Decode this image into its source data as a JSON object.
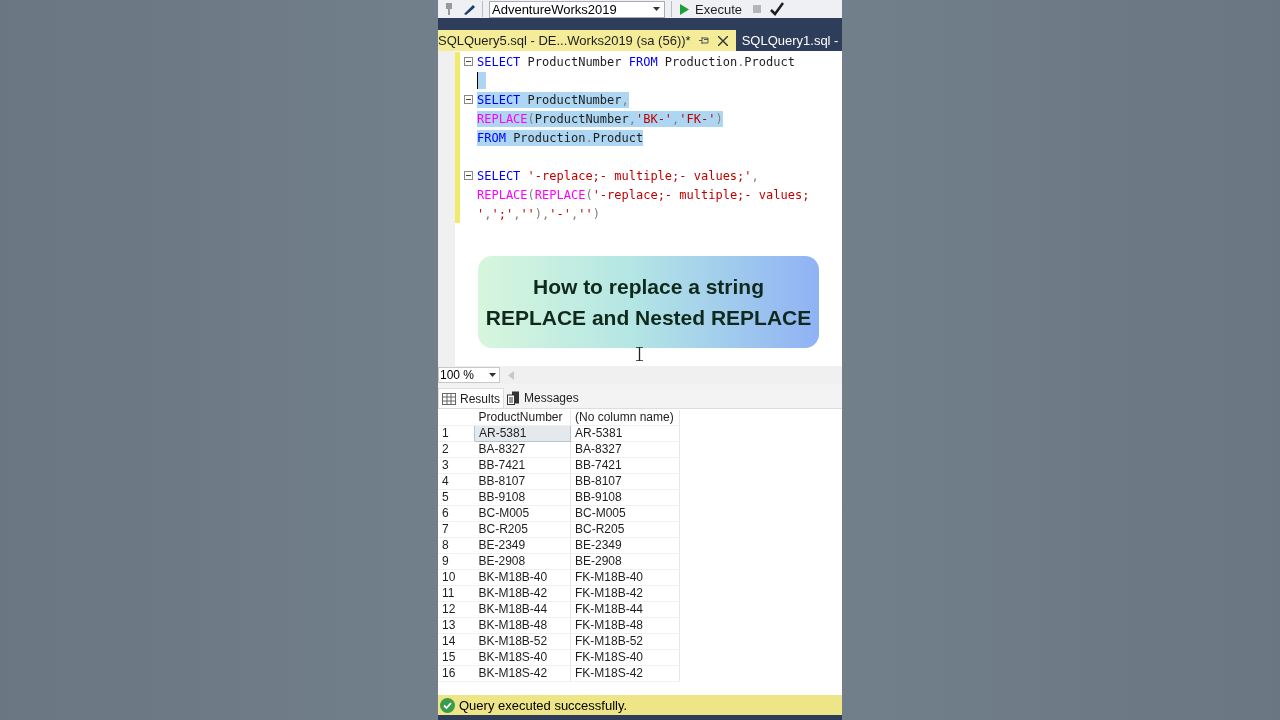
{
  "toolbar": {
    "database": "AdventureWorks2019",
    "execute": "Execute"
  },
  "tabs": [
    {
      "label": "SQLQuery5.sql - DE...Works2019 (sa (56))*",
      "selected": true
    },
    {
      "label": "SQLQuery1.sql -",
      "selected": false
    }
  ],
  "editor": {
    "lines": [
      {
        "fold": true,
        "selected": false,
        "tokens": [
          {
            "kind": "kw",
            "text": "SELECT"
          },
          {
            "kind": "id",
            "text": " ProductNumber "
          },
          {
            "kind": "kw",
            "text": "FROM"
          },
          {
            "kind": "id",
            "text": " Production"
          },
          {
            "kind": "punct",
            "text": "."
          },
          {
            "kind": "id",
            "text": "Product"
          }
        ]
      },
      {
        "fold": false,
        "selected": true
      },
      {
        "fold": true,
        "selected": true,
        "tokens": [
          {
            "kind": "kw",
            "text": "SELECT"
          },
          {
            "kind": "id",
            "text": " ProductNumber"
          },
          {
            "kind": "punct",
            "text": ","
          }
        ]
      },
      {
        "fold": false,
        "selected": true,
        "tokens": [
          {
            "kind": "fn",
            "text": "REPLACE"
          },
          {
            "kind": "punct",
            "text": "("
          },
          {
            "kind": "id",
            "text": "ProductNumber"
          },
          {
            "kind": "punct",
            "text": ","
          },
          {
            "kind": "str",
            "text": "'BK-'"
          },
          {
            "kind": "punct",
            "text": ","
          },
          {
            "kind": "str",
            "text": "'FK-'"
          },
          {
            "kind": "punct",
            "text": ")"
          }
        ]
      },
      {
        "fold": false,
        "selected": true,
        "tokens": [
          {
            "kind": "kw",
            "text": "FROM"
          },
          {
            "kind": "id",
            "text": " Production"
          },
          {
            "kind": "punct",
            "text": "."
          },
          {
            "kind": "id",
            "text": "Product"
          }
        ]
      },
      {
        "fold": false,
        "selected": false
      },
      {
        "fold": true,
        "selected": false,
        "tokens": [
          {
            "kind": "kw",
            "text": "SELECT "
          },
          {
            "kind": "str",
            "text": "'-replace;- multiple;- values;'"
          },
          {
            "kind": "punct",
            "text": ","
          }
        ]
      },
      {
        "fold": false,
        "selected": false,
        "tokens": [
          {
            "kind": "fn",
            "text": "REPLACE"
          },
          {
            "kind": "punct",
            "text": "("
          },
          {
            "kind": "fn",
            "text": "REPLACE"
          },
          {
            "kind": "punct",
            "text": "("
          },
          {
            "kind": "str",
            "text": "'-replace;- multiple;- values;"
          }
        ]
      },
      {
        "fold": false,
        "selected": false,
        "tokens": [
          {
            "kind": "str",
            "text": "'"
          },
          {
            "kind": "punct",
            "text": ","
          },
          {
            "kind": "str",
            "text": "';'"
          },
          {
            "kind": "punct",
            "text": ","
          },
          {
            "kind": "str",
            "text": "''"
          },
          {
            "kind": "punct",
            "text": "),"
          },
          {
            "kind": "str",
            "text": "'-'"
          },
          {
            "kind": "punct",
            "text": ","
          },
          {
            "kind": "str",
            "text": "''"
          },
          {
            "kind": "punct",
            "text": ")"
          }
        ]
      }
    ]
  },
  "banner": {
    "lines": [
      "How to replace a string",
      "REPLACE and Nested REPLACE"
    ]
  },
  "zoom": "100 %",
  "result_tabs": [
    {
      "label": "Results",
      "selected": true
    },
    {
      "label": "Messages",
      "selected": false
    }
  ],
  "table": {
    "columns": [
      "ProductNumber",
      "(No column name)"
    ],
    "rows": [
      {
        "number": "1",
        "cells": [
          "AR-5381",
          "AR-5381"
        ],
        "selected": true
      },
      {
        "number": "2",
        "cells": [
          "BA-8327",
          "BA-8327"
        ],
        "selected": false
      },
      {
        "number": "3",
        "cells": [
          "BB-7421",
          "BB-7421"
        ],
        "selected": false
      },
      {
        "number": "4",
        "cells": [
          "BB-8107",
          "BB-8107"
        ],
        "selected": false
      },
      {
        "number": "5",
        "cells": [
          "BB-9108",
          "BB-9108"
        ],
        "selected": false
      },
      {
        "number": "6",
        "cells": [
          "BC-M005",
          "BC-M005"
        ],
        "selected": false
      },
      {
        "number": "7",
        "cells": [
          "BC-R205",
          "BC-R205"
        ],
        "selected": false
      },
      {
        "number": "8",
        "cells": [
          "BE-2349",
          "BE-2349"
        ],
        "selected": false
      },
      {
        "number": "9",
        "cells": [
          "BE-2908",
          "BE-2908"
        ],
        "selected": false
      },
      {
        "number": "10",
        "cells": [
          "BK-M18B-40",
          "FK-M18B-40"
        ],
        "selected": false
      },
      {
        "number": "11",
        "cells": [
          "BK-M18B-42",
          "FK-M18B-42"
        ],
        "selected": false
      },
      {
        "number": "12",
        "cells": [
          "BK-M18B-44",
          "FK-M18B-44"
        ],
        "selected": false
      },
      {
        "number": "13",
        "cells": [
          "BK-M18B-48",
          "FK-M18B-48"
        ],
        "selected": false
      },
      {
        "number": "14",
        "cells": [
          "BK-M18B-52",
          "FK-M18B-52"
        ],
        "selected": false
      },
      {
        "number": "15",
        "cells": [
          "BK-M18S-40",
          "FK-M18S-40"
        ],
        "selected": false
      },
      {
        "number": "16",
        "cells": [
          "BK-M18S-42",
          "FK-M18S-42"
        ],
        "selected": false
      }
    ]
  },
  "status_bar": {
    "message": "Query executed successfully."
  }
}
